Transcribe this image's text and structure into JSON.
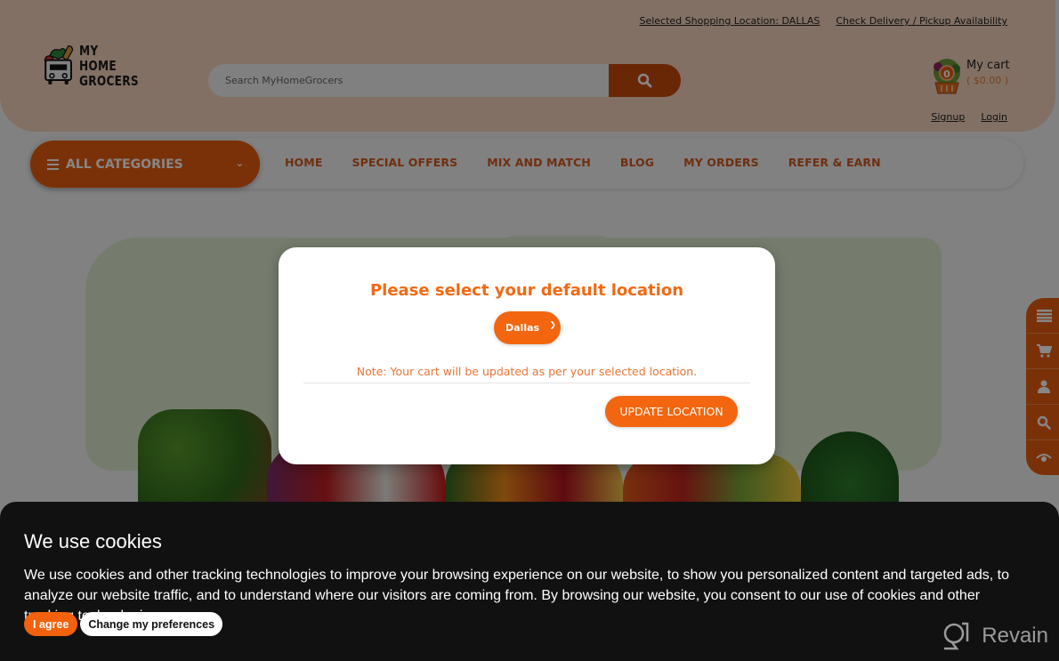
{
  "header": {
    "top_links": {
      "location": "Selected Shopping Location: DALLAS",
      "availability": "Check Delivery / Pickup Availability"
    },
    "logo": {
      "line1": "MY HOME",
      "line2": "GROCERS"
    },
    "search": {
      "placeholder": "Search MyHomeGrocers",
      "value": ""
    },
    "cart": {
      "label": "My cart",
      "amount": "( $0.00 )",
      "count": "0"
    },
    "auth": {
      "signup": "Signup",
      "login": "Login"
    }
  },
  "nav": {
    "all_categories": "ALL CATEGORIES",
    "links": [
      "HOME",
      "SPECIAL OFFERS",
      "MIX AND MATCH",
      "BLOG",
      "MY ORDERS",
      "REFER & EARN"
    ]
  },
  "side_tools": [
    "menu-icon",
    "cart-icon",
    "user-icon",
    "search-icon",
    "eye-icon"
  ],
  "modal": {
    "title": "Please select your default location",
    "selected_location": "Dallas",
    "note": "Note: Your cart will be updated as per your selected location.",
    "button": "UPDATE LOCATION"
  },
  "cookie_banner": {
    "title": "We use cookies",
    "text": "We use cookies and other tracking technologies to improve your browsing experience on our website, to show you personalized content and targeted ads, to analyze our website traffic, and to understand where our visitors are coming from. By browsing our website, you consent to our use of cookies and other tracking technologies.",
    "agree": "I agree",
    "preferences": "Change my preferences"
  },
  "watermark": "Revain",
  "colors": {
    "brand_orange": "#f3660f",
    "header_bg": "#f5d3bd",
    "nav_link": "#d2591f",
    "cookie_bg": "#111111"
  }
}
